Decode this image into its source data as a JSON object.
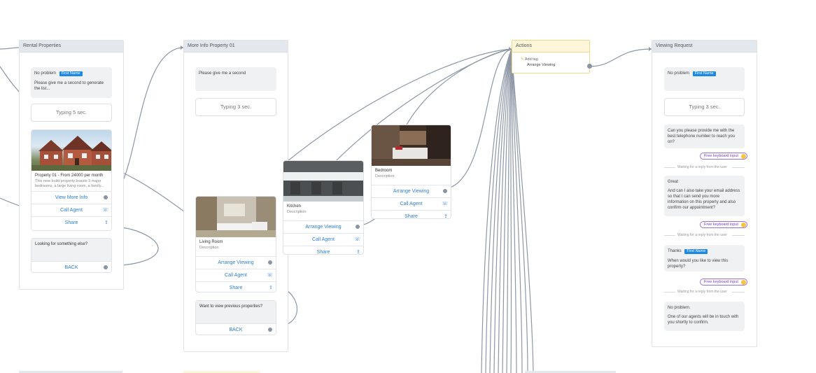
{
  "nodes": {
    "rental": {
      "title": "Rental Properties",
      "bubble1_text": "No problem",
      "bubble1_chip": "First Name",
      "bubble1_text2": "Please give me a second to generate the list...",
      "typing": "Typing 5 sec.",
      "card_title": "Property 01 - From 24000 per month",
      "card_desc": "This new build property boasts 3 major bedrooms, a large living room, a family...",
      "btn_view": "View More Info",
      "btn_call": "Call Agent",
      "btn_share": "Share",
      "bubble2_text": "Looking for something else?",
      "btn_back": "BACK"
    },
    "moreinfo": {
      "title": "More Info Property 01",
      "bubble1_text": "Please give me a second",
      "typing": "Typing 3 sec.",
      "card_title": "Living Room",
      "card_desc": "Description",
      "btn_arrange": "Arrange Viewing",
      "btn_call": "Call Agent",
      "btn_share": "Share",
      "bubble2_text": "Want to view previous properties?",
      "btn_back": "BACK"
    },
    "kitchen": {
      "card_title": "Kitchen",
      "card_desc": "Description",
      "btn_arrange": "Arrange Viewing",
      "btn_call": "Call Agent",
      "btn_share": "Share"
    },
    "bedroom": {
      "card_title": "Bedroom",
      "card_desc": "Description",
      "btn_arrange": "Arrange Viewing",
      "btn_call": "Call Agent",
      "btn_share": "Share"
    },
    "actions": {
      "title": "Actions",
      "line1": "Add tag",
      "line2": "Arrange Viewing"
    },
    "viewing": {
      "title": "Viewing Request",
      "bubble1_text": "No problem",
      "bubble1_chip": "First Name",
      "typing": "Typing 3 sec.",
      "bubble2_text": "Can you please provide me with the best telephone number to reach you on?",
      "kbd1": "Free keyboard input",
      "wait1": "Waiting for a reply from the user",
      "bubble3_line1": "Great",
      "bubble3_text": "And can I also take your email address so that I can send you more information on this property and also confirm our appointment?",
      "kbd2": "Free keyboard input",
      "wait2": "Waiting for a reply from the user",
      "bubble4_text": "Thanks",
      "bubble4_chip": "First Name",
      "bubble4_text2": "When would you like to view this property?",
      "kbd3": "Free keyboard input",
      "wait3": "Waiting for a reply from the user",
      "bubble5_line1": "No problem.",
      "bubble5_text": "One of our agents will be in touch with you shortly to confirm."
    }
  },
  "icons": {
    "call": "call-icon",
    "share": "share-icon",
    "connector": "connector-dot-icon",
    "keyboard_badge": "keyboard-icon",
    "tag": "tag-icon"
  },
  "colors": {
    "accent_blue": "#2b7ed3",
    "chip_blue": "#1e88e5",
    "header_gray": "#e3e8ef",
    "header_yellow": "#fdf6d8",
    "wire": "#8a94a3",
    "kbd_purple": "#9b6fd6"
  }
}
